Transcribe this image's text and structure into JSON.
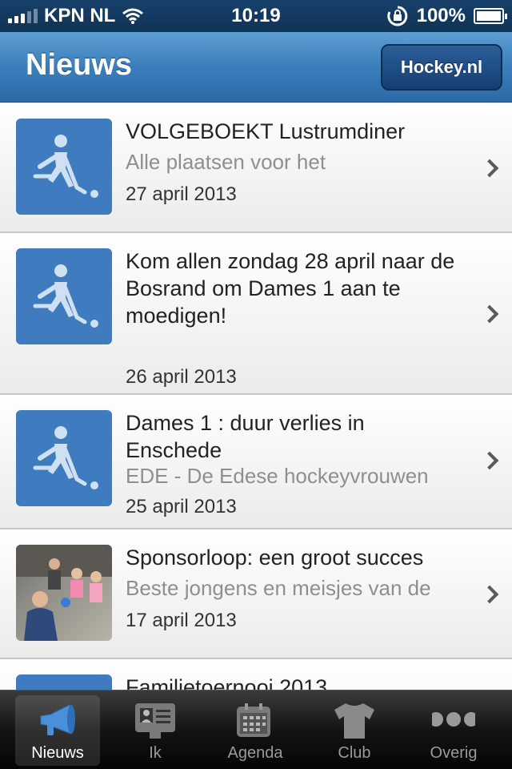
{
  "status_bar": {
    "carrier": "KPN NL",
    "time": "10:19",
    "battery_percent": "100%"
  },
  "nav": {
    "title": "Nieuws",
    "right_button": "Hockey.nl"
  },
  "news_items": [
    {
      "title": "VOLGEBOEKT Lustrumdiner",
      "subtitle": "Alle plaatsen voor het",
      "date": "27 april 2013",
      "thumbnail": "hockey-player-icon"
    },
    {
      "title": "Kom allen zondag 28 april naar de Bosrand om Dames 1 aan te moedigen!",
      "subtitle": "",
      "date": "26 april 2013",
      "thumbnail": "hockey-player-icon"
    },
    {
      "title": "Dames 1 : duur verlies in Enschede",
      "subtitle": "EDE - De Edese hockeyvrouwen",
      "date": "25 april 2013",
      "thumbnail": "hockey-player-icon"
    },
    {
      "title": "Sponsorloop: een groot succes",
      "subtitle": "Beste jongens en meisjes van de",
      "date": "17 april 2013",
      "thumbnail": "photo"
    },
    {
      "title": "Familietoernooi 2013",
      "subtitle": "",
      "date": "",
      "thumbnail": "hockey-player-icon"
    }
  ],
  "tab_bar": {
    "tabs": [
      {
        "label": "Nieuws",
        "icon": "megaphone-icon",
        "active": true
      },
      {
        "label": "Ik",
        "icon": "id-card-icon",
        "active": false
      },
      {
        "label": "Agenda",
        "icon": "calendar-icon",
        "active": false
      },
      {
        "label": "Club",
        "icon": "shirt-icon",
        "active": false
      },
      {
        "label": "Overig",
        "icon": "more-dots-icon",
        "active": false
      }
    ]
  },
  "colors": {
    "nav_blue": "#3a7fbd",
    "thumb_blue": "#3e7bbf",
    "tab_active_icon": "#4a90d9"
  }
}
